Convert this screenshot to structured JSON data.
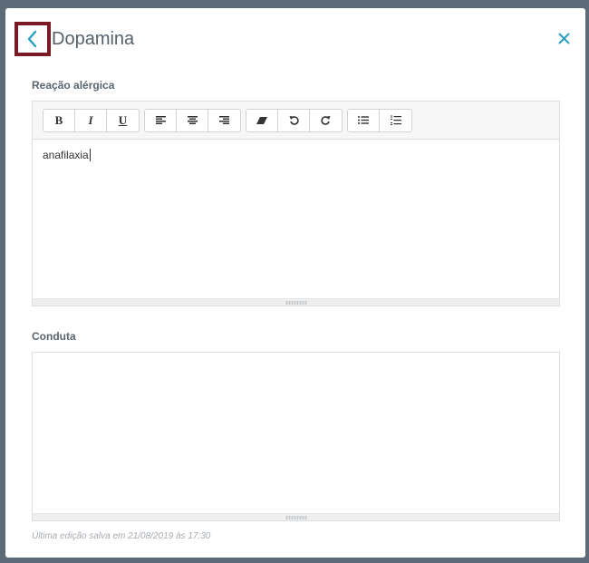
{
  "header": {
    "title": "Dopamina",
    "back_icon": "chevron-left-icon",
    "close_icon": "close-icon",
    "accent_color": "#2a9fc2",
    "highlight_color": "#7a1a24"
  },
  "fields": [
    {
      "label": "Reação alérgica",
      "value": "anafilaxia",
      "has_toolbar": true
    },
    {
      "label": "Conduta",
      "value": "",
      "has_toolbar": false
    }
  ],
  "toolbar": {
    "bold": "B",
    "italic": "I",
    "underline": "U",
    "icons": [
      "align-left-icon",
      "align-center-icon",
      "align-right-icon",
      "eraser-icon",
      "undo-icon",
      "redo-icon",
      "bullet-list-icon",
      "numbered-list-icon"
    ]
  },
  "footer": {
    "last_edit": "Última edição salva em 21/08/2019 às 17:30"
  }
}
